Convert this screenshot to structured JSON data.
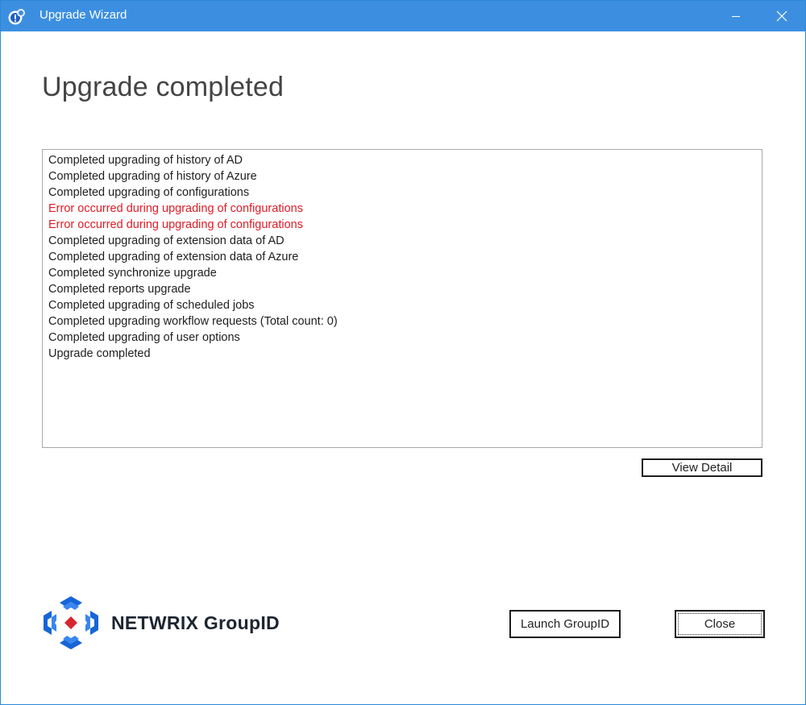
{
  "window": {
    "title": "Upgrade Wizard",
    "accent_color": "#3c8fe0",
    "controls": {
      "minimize_icon": "minimize-icon",
      "close_icon": "close-icon"
    }
  },
  "page": {
    "heading": "Upgrade completed"
  },
  "log": {
    "lines": [
      {
        "text": "Completed upgrading of history of AD",
        "status": "ok"
      },
      {
        "text": "Completed upgrading of history of Azure",
        "status": "ok"
      },
      {
        "text": "Completed upgrading of configurations",
        "status": "ok"
      },
      {
        "text": "Error occurred during upgrading of configurations",
        "status": "error"
      },
      {
        "text": "Error occurred during upgrading of configurations",
        "status": "error"
      },
      {
        "text": "Completed upgrading of extension data of AD",
        "status": "ok"
      },
      {
        "text": "Completed upgrading of extension data of Azure",
        "status": "ok"
      },
      {
        "text": "Completed synchronize upgrade",
        "status": "ok"
      },
      {
        "text": "Completed reports upgrade",
        "status": "ok"
      },
      {
        "text": "Completed upgrading of scheduled jobs",
        "status": "ok"
      },
      {
        "text": "Completed upgrading workflow requests (Total count: 0)",
        "status": "ok"
      },
      {
        "text": "Completed upgrading of user options",
        "status": "ok"
      },
      {
        "text": "Upgrade completed",
        "status": "ok"
      }
    ],
    "error_color": "#e01b24"
  },
  "buttons": {
    "view_detail": "View Detail",
    "launch": "Launch GroupID",
    "close": "Close"
  },
  "branding": {
    "logo_text": "NETWRIX GroupID",
    "logo_blue": "#1565d8",
    "logo_red": "#d7262f"
  }
}
